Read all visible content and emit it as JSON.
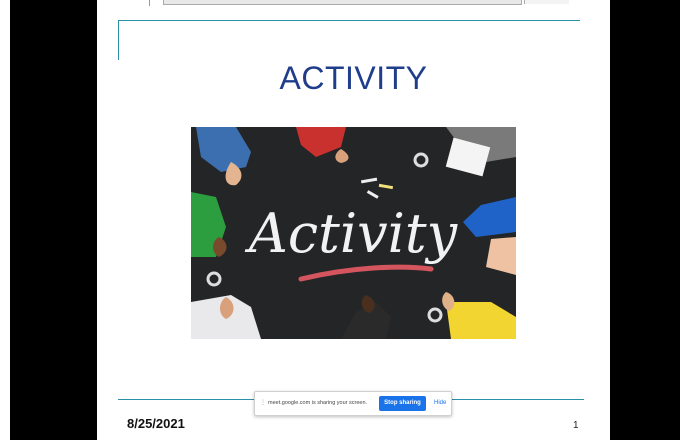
{
  "slide": {
    "title": "ACTIVITY",
    "image_text": "Activity",
    "date": "8/25/2021",
    "page_number": "1"
  },
  "share_bar": {
    "message": "meet.google.com is sharing your screen.",
    "stop_label": "Stop sharing",
    "hide_label": "Hide"
  },
  "colors": {
    "title": "#1f3d8a",
    "accent": "#2a8fa8",
    "stop_button": "#1a73e8"
  }
}
